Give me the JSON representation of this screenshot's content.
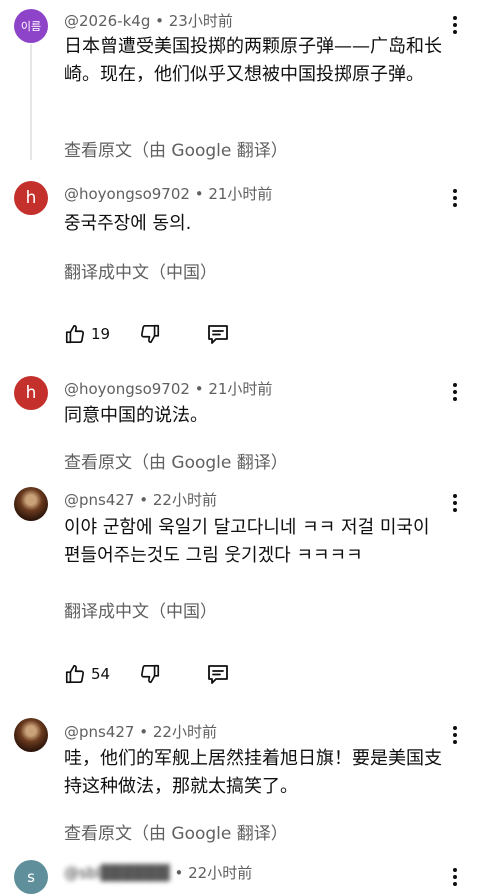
{
  "comments": [
    {
      "avatar_text": "이름",
      "author": "@2026-k4g",
      "time": "23小时前",
      "text": "日本曾遭受美国投掷的两颗原子弹——广岛和长崎。现在，他们似乎又想被中国投掷原子弹。",
      "translate_label": "查看原文（由 Google 翻译）"
    },
    {
      "avatar_text": "h",
      "author": "@hoyongso9702",
      "time": "21小时前",
      "text": "중국주장에 동의.",
      "translate_label": "翻译成中文（中国）",
      "likes": "19"
    },
    {
      "avatar_text": "h",
      "author": "@hoyongso9702",
      "time": "21小时前",
      "text": "同意中国的说法。",
      "translate_label": "查看原文（由 Google 翻译）"
    },
    {
      "author": "@pns427",
      "time": "22小时前",
      "text": "이야 군함에 욱일기 달고다니네 ㅋㅋ 저걸 미국이 편들어주는것도 그림 웃기겠다 ㅋㅋㅋㅋ",
      "translate_label": "翻译成中文（中国）",
      "likes": "54"
    },
    {
      "author": "@pns427",
      "time": "22小时前",
      "text": "哇，他们的军舰上居然挂着旭日旗！要是美国支持这种做法，那就太搞笑了。",
      "translate_label": "查看原文（由 Google 翻译）"
    },
    {
      "avatar_text": "s",
      "author": "@sbl▓▓▓▓▓▓",
      "time": "22小时前"
    }
  ],
  "separator": " • ",
  "icons": {
    "like": "thumbs-up-icon",
    "dislike": "thumbs-down-icon",
    "reply": "reply-icon",
    "more": "more-vertical-icon"
  },
  "colors": {
    "purple_avatar": "#8e44c9",
    "red_avatar": "#c4302b",
    "gray_avatar": "#5f8f9a"
  }
}
